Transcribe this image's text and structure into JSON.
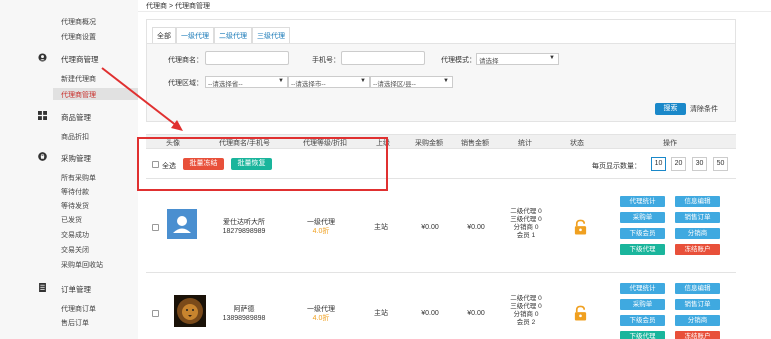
{
  "breadcrumb": "代理商 > 代理商管理",
  "sidebar": {
    "pre_items": [
      {
        "label": "代理商概况"
      },
      {
        "label": "代理商设置"
      }
    ],
    "groups": [
      {
        "title": "代理商管理",
        "icon": "user-circle-icon",
        "items": [
          {
            "label": "新建代理商"
          },
          {
            "label": "代理商管理"
          }
        ]
      },
      {
        "title": "商品管理",
        "icon": "grid-icon",
        "items": [
          {
            "label": "商品折扣"
          }
        ]
      },
      {
        "title": "采购管理",
        "icon": "bag-icon",
        "items": [
          {
            "label": "所有采购单"
          },
          {
            "label": "等待付款"
          },
          {
            "label": "等待发货"
          },
          {
            "label": "已发货"
          },
          {
            "label": "交易成功"
          },
          {
            "label": "交易关闭"
          },
          {
            "label": "采购单回收站"
          }
        ]
      },
      {
        "title": "订单管理",
        "icon": "document-icon",
        "items": [
          {
            "label": "代理商订单"
          },
          {
            "label": "售后订单"
          }
        ]
      }
    ]
  },
  "tabs": [
    "全部",
    "一级代理",
    "二级代理",
    "三级代理"
  ],
  "filters": {
    "name_label": "代理商名：",
    "phone_label": "手机号：",
    "mode_label": "代理模式：",
    "mode_value": "请选择",
    "region_label": "代理区域：",
    "province": "--请选择省--",
    "city": "--请选择市--",
    "district": "--请选择区/县--",
    "search_btn": "搜索",
    "clear_btn": "清除条件"
  },
  "table": {
    "headers": [
      "头像",
      "代理商名/手机号",
      "代理等级/折扣",
      "上级",
      "采购金额",
      "销售金额",
      "统计",
      "状态",
      "操作"
    ],
    "select_all": "全选",
    "bulk_freeze": "批量冻结",
    "bulk_restore": "批量恢复",
    "page_size_label": "每页显示数量：",
    "page_sizes": [
      "10",
      "20",
      "30",
      "50"
    ],
    "rows": [
      {
        "name": "爱仕达听大所",
        "phone": "18279898989",
        "level": "一级代理",
        "discount": "4.0折",
        "parent": "主站",
        "purchase": "¥0.00",
        "sales": "¥0.00",
        "stats": [
          "二级代理 0",
          "三级代理 0",
          "分销商 0",
          "会员 1"
        ],
        "ops": [
          "代理统计",
          "信息编辑",
          "采购单",
          "销售订单",
          "下级会员",
          "分销商",
          "下级代理",
          "冻结账户"
        ]
      },
      {
        "name": "阿萨德",
        "phone": "13898989898",
        "level": "一级代理",
        "discount": "4.0折",
        "parent": "主站",
        "purchase": "¥0.00",
        "sales": "¥0.00",
        "stats": [
          "二级代理 0",
          "三级代理 0",
          "分销商 0",
          "会员 2"
        ],
        "ops": [
          "代理统计",
          "信息编辑",
          "采购单",
          "销售订单",
          "下级会员",
          "分销商",
          "下级代理",
          "冻结账户"
        ]
      }
    ]
  },
  "colors": {
    "accent_blue": "#1a88c9",
    "red": "#e8503a",
    "teal": "#1ab59c",
    "orange": "#f0a020"
  }
}
